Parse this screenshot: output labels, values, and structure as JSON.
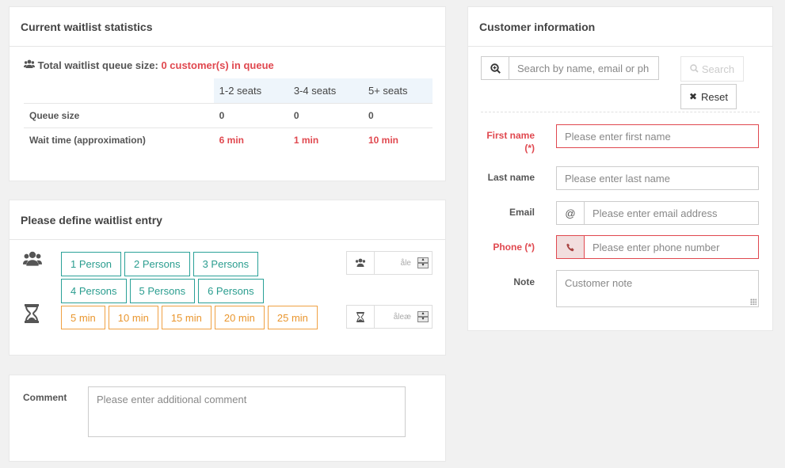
{
  "stats": {
    "title": "Current waitlist statistics",
    "total_label": "Total waitlist queue size:",
    "total_value": "0 customer(s) in queue",
    "columns": [
      "1-2 seats",
      "3-4 seats",
      "5+ seats"
    ],
    "rows": [
      {
        "label": "Queue size",
        "values": [
          "0",
          "0",
          "0"
        ]
      },
      {
        "label": "Wait time (approximation)",
        "values": [
          "6 min",
          "1 min",
          "10 min"
        ]
      }
    ]
  },
  "entry": {
    "title": "Please define waitlist entry",
    "person_options": [
      "1 Person",
      "2 Persons",
      "3 Persons",
      "4 Persons",
      "5 Persons",
      "6 Persons"
    ],
    "time_options": [
      "5 min",
      "10 min",
      "15 min",
      "20 min",
      "25 min"
    ],
    "party_spinner_text": "åle",
    "time_spinner_text": "åleæ"
  },
  "comment": {
    "label": "Comment",
    "placeholder": "Please enter additional comment"
  },
  "customer": {
    "title": "Customer information",
    "search_placeholder": "Search by name, email or ph",
    "search_button": "Search",
    "reset_button": "Reset",
    "first_name_label": "First name",
    "first_name_req": "(*)",
    "first_name_placeholder": "Please enter first name",
    "last_name_label": "Last name",
    "last_name_placeholder": "Please enter last name",
    "email_label": "Email",
    "email_placeholder": "Please enter email address",
    "phone_label": "Phone (*)",
    "phone_placeholder": "Please enter phone number",
    "note_label": "Note",
    "note_placeholder": "Customer note"
  },
  "colors": {
    "accent_red": "#e0484f",
    "green": "#2a9d8f",
    "orange": "#e9962e"
  }
}
